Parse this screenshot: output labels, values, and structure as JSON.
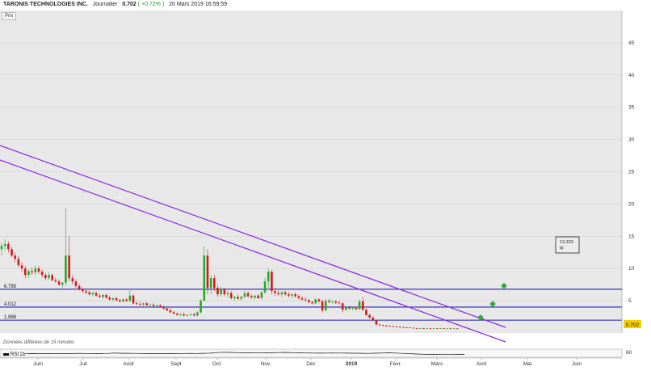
{
  "header": {
    "name": "TARONIS TECHNOLOGIES INC.",
    "period": "Journalier",
    "price": "0.702",
    "change": "( +0.72% )",
    "datetime": "20 Mars 2019 16:59:59"
  },
  "panel_label": "Prix",
  "delayed_note": "Données différées de 15 minutes",
  "rsi_label": "RSI 21",
  "last_price_tag": "0.702",
  "annotation": {
    "value": "13.323",
    "sub": "tp"
  },
  "colors": {
    "plot_bg": "#e8e8e8",
    "grid": "#d2d2d2",
    "up": "#2aa82a",
    "down": "#d11c1c",
    "hline": "#1f22b8",
    "trend": "#8a2be2",
    "diamond": "#33b033",
    "tag": "#f5d000"
  },
  "chart_data": [
    {
      "type": "candlestick",
      "title": "",
      "xlabel": "",
      "ylabel": "",
      "ylim": [
        0,
        50
      ],
      "y_ticks": [
        "5",
        "10",
        "15",
        "20",
        "25",
        "30",
        "35",
        "40",
        "45"
      ],
      "x_labels": [
        "Juin",
        "Juil",
        "Août",
        "Sept",
        "Oct.",
        "Nov.",
        "Déc",
        "2019",
        "Févr.",
        "Mars",
        "Avril",
        "Mai",
        "Juin"
      ],
      "grid": true,
      "horizontal_levels": [
        {
          "label": "6.795",
          "value": 6.795
        },
        {
          "label": "4.012",
          "value": 4.012
        },
        {
          "label": "1.988",
          "value": 1.988
        }
      ],
      "last_price": 0.702,
      "series": [
        {
          "values": [
            [
              13,
              14,
              12,
              13.5
            ],
            [
              13.5,
              14.5,
              12.8,
              13.8
            ],
            [
              13.8,
              14.2,
              12.5,
              13
            ],
            [
              13,
              13.4,
              11.8,
              12
            ],
            [
              12,
              12.5,
              11,
              11.5
            ],
            [
              11.5,
              12,
              10.2,
              10.5
            ],
            [
              10.5,
              11,
              9.5,
              10
            ],
            [
              10,
              10.4,
              8.5,
              9
            ],
            [
              9,
              10,
              8.6,
              9.6
            ],
            [
              9.6,
              10.2,
              9,
              9.4
            ],
            [
              9.4,
              10.5,
              9,
              10
            ],
            [
              10,
              10.4,
              9.2,
              9.5
            ],
            [
              9.5,
              9.8,
              8.6,
              9
            ],
            [
              9,
              9.3,
              8.2,
              8.5
            ],
            [
              8.5,
              9.4,
              8.2,
              9
            ],
            [
              9,
              9.2,
              8,
              8.2
            ],
            [
              8.2,
              8.6,
              7.8,
              8
            ],
            [
              8,
              8.3,
              7.3,
              7.5
            ],
            [
              7.5,
              7.9,
              7,
              7.8
            ],
            [
              7.8,
              19.3,
              7.4,
              12
            ],
            [
              12,
              15,
              8,
              8.5
            ],
            [
              8.5,
              9,
              7.5,
              8
            ],
            [
              8,
              8.3,
              7,
              7.3
            ],
            [
              7.3,
              7.6,
              6.6,
              6.8
            ],
            [
              6.8,
              7.1,
              6.2,
              6.5
            ],
            [
              6.5,
              6.8,
              6,
              6.3
            ],
            [
              6.3,
              6.6,
              5.8,
              6
            ],
            [
              6,
              6.4,
              5.7,
              6.2
            ],
            [
              6.2,
              6.4,
              5.6,
              5.8
            ],
            [
              5.8,
              6.1,
              5.4,
              5.6
            ],
            [
              5.6,
              6,
              5.3,
              5.9
            ],
            [
              5.9,
              6.1,
              5.3,
              5.5
            ],
            [
              5.5,
              5.8,
              5,
              5.2
            ],
            [
              5.2,
              5.5,
              4.9,
              5.4
            ],
            [
              5.4,
              5.6,
              4.9,
              5.1
            ],
            [
              5.1,
              5.3,
              4.7,
              4.9
            ],
            [
              4.9,
              5.4,
              4.7,
              5.2
            ],
            [
              5.2,
              5.4,
              4.8,
              5
            ],
            [
              5,
              6.6,
              4.9,
              5.8
            ],
            [
              5.8,
              6,
              4.4,
              4.6
            ],
            [
              4.6,
              4.9,
              4.3,
              4.5
            ],
            [
              4.5,
              4.8,
              4.2,
              4.4
            ],
            [
              4.4,
              4.7,
              4.1,
              4.6
            ],
            [
              4.6,
              4.8,
              4.2,
              4.3
            ],
            [
              4.3,
              4.6,
              4,
              4.4
            ],
            [
              4.4,
              4.6,
              4.1,
              4.2
            ],
            [
              4.2,
              4.5,
              3.9,
              4.3
            ],
            [
              4.3,
              4.5,
              3.9,
              4
            ],
            [
              4,
              4.3,
              3.6,
              3.8
            ],
            [
              3.8,
              4.1,
              3.4,
              3.5
            ],
            [
              3.5,
              3.8,
              3.1,
              3.2
            ],
            [
              3.2,
              3.5,
              2.9,
              3
            ],
            [
              3,
              3.2,
              2.7,
              2.8
            ],
            [
              2.8,
              3.1,
              2.6,
              2.9
            ],
            [
              2.9,
              3.2,
              2.6,
              2.7
            ],
            [
              2.7,
              3,
              2.5,
              2.8
            ],
            [
              2.8,
              3.1,
              2.6,
              2.9
            ],
            [
              2.9,
              3.2,
              2.6,
              2.7
            ],
            [
              2.7,
              3.4,
              2.6,
              3.2
            ],
            [
              3.2,
              5.3,
              3,
              5
            ],
            [
              5,
              13.5,
              5,
              12
            ],
            [
              12,
              13,
              6,
              7
            ],
            [
              7,
              9,
              6,
              8.5
            ],
            [
              8.5,
              9,
              6.5,
              7
            ],
            [
              7,
              7.5,
              5.6,
              6
            ],
            [
              6,
              7.2,
              5.6,
              6.8
            ],
            [
              6.8,
              7,
              5.7,
              6
            ],
            [
              6,
              6.5,
              5.5,
              6.2
            ],
            [
              6.2,
              6.5,
              5.2,
              5.4
            ],
            [
              5.4,
              5.8,
              5,
              5.6
            ],
            [
              5.6,
              6,
              5.2,
              5.3
            ],
            [
              5.3,
              5.8,
              5,
              5.6
            ],
            [
              5.6,
              6.5,
              5.4,
              6.2
            ],
            [
              6.2,
              6.4,
              5.5,
              5.7
            ],
            [
              5.7,
              6,
              5.3,
              5.5
            ],
            [
              5.5,
              5.9,
              5.2,
              5.8
            ],
            [
              5.8,
              6,
              5.3,
              5.4
            ],
            [
              5.4,
              6.5,
              5.2,
              6.3
            ],
            [
              6.3,
              8.6,
              6,
              8
            ],
            [
              8,
              10,
              7,
              9.5
            ],
            [
              9.5,
              9.8,
              6,
              6.5
            ],
            [
              6.5,
              7,
              5.8,
              6.2
            ],
            [
              6.2,
              6.6,
              5.7,
              6
            ],
            [
              6,
              6.5,
              5.6,
              6.3
            ],
            [
              6.3,
              6.6,
              5.8,
              6
            ],
            [
              6,
              6.4,
              5.5,
              5.8
            ],
            [
              5.8,
              6.2,
              5.4,
              6
            ],
            [
              6,
              6.3,
              5.5,
              5.7
            ],
            [
              5.7,
              6,
              5.2,
              5.4
            ],
            [
              5.4,
              5.7,
              5,
              5.2
            ],
            [
              5.2,
              5.5,
              4.8,
              5.1
            ],
            [
              5.1,
              5.3,
              4.6,
              4.8
            ],
            [
              4.8,
              5,
              4.4,
              4.6
            ],
            [
              4.6,
              5.4,
              4.5,
              5.2
            ],
            [
              5.2,
              5.4,
              4.7,
              4.9
            ],
            [
              4.9,
              5.2,
              3.2,
              3.5
            ],
            [
              3.5,
              5.3,
              3.4,
              5
            ],
            [
              5,
              5.3,
              4.6,
              4.8
            ],
            [
              4.8,
              5.1,
              4.5,
              4.9
            ],
            [
              4.9,
              5.1,
              4.5,
              4.7
            ],
            [
              4.7,
              5,
              4.4,
              4.6
            ],
            [
              4.6,
              4.8,
              3.2,
              3.6
            ],
            [
              3.6,
              4.2,
              3.4,
              4
            ],
            [
              4,
              4.2,
              3.6,
              3.8
            ],
            [
              3.8,
              4.1,
              3.5,
              3.9
            ],
            [
              3.9,
              4.1,
              3.5,
              3.7
            ],
            [
              3.7,
              5.2,
              3.6,
              4.9
            ],
            [
              4.9,
              5.6,
              3.4,
              3.6
            ],
            [
              3.6,
              3.8,
              2.6,
              2.8
            ],
            [
              2.8,
              3,
              2.2,
              2.4
            ],
            [
              2.4,
              2.6,
              1.8,
              2
            ],
            [
              2,
              2.1,
              1.2,
              1.3
            ],
            [
              1.3,
              1.4,
              1.1,
              1.2
            ],
            [
              1.2,
              1.3,
              1.1,
              1.15
            ],
            [
              1.15,
              1.25,
              1,
              1.1
            ],
            [
              1.1,
              1.2,
              1,
              1.05
            ],
            [
              1.05,
              1.15,
              0.95,
              1
            ],
            [
              1,
              1.1,
              0.9,
              0.95
            ],
            [
              0.95,
              1.05,
              0.88,
              0.9
            ],
            [
              0.9,
              1,
              0.85,
              0.88
            ],
            [
              0.88,
              0.95,
              0.82,
              0.85
            ],
            [
              0.85,
              0.9,
              0.78,
              0.8
            ],
            [
              0.8,
              0.85,
              0.72,
              0.75
            ],
            [
              0.75,
              0.8,
              0.68,
              0.7
            ],
            [
              0.7,
              0.78,
              0.66,
              0.74
            ],
            [
              0.74,
              0.78,
              0.68,
              0.7
            ],
            [
              0.7,
              0.76,
              0.66,
              0.72
            ],
            [
              0.72,
              0.76,
              0.66,
              0.68
            ],
            [
              0.68,
              0.74,
              0.64,
              0.72
            ],
            [
              0.72,
              0.76,
              0.66,
              0.7
            ],
            [
              0.7,
              0.74,
              0.65,
              0.72
            ],
            [
              0.72,
              0.75,
              0.66,
              0.69
            ],
            [
              0.69,
              0.74,
              0.65,
              0.71
            ],
            [
              0.71,
              0.74,
              0.66,
              0.7
            ],
            [
              0.7,
              0.73,
              0.66,
              0.71
            ],
            [
              0.71,
              0.74,
              0.67,
              0.702
            ]
          ]
        }
      ],
      "signal_points": [
        {
          "label": "2019-04",
          "value": 2.4
        },
        {
          "label": "2019-04",
          "value": 4.5
        },
        {
          "label": "2019-04",
          "value": 7.3
        }
      ]
    },
    {
      "type": "line",
      "title": "RSI 21",
      "ylim": [
        0,
        100
      ],
      "y_ticks": [
        "60"
      ],
      "series": [
        {
          "name": "RSI 21",
          "values": [
            42,
            45,
            44,
            46,
            47,
            45,
            44,
            46,
            48,
            47,
            46,
            45,
            47,
            52,
            50,
            49,
            48,
            47,
            46,
            45,
            44,
            45,
            46,
            47,
            48,
            47,
            49,
            50,
            58,
            62,
            60,
            57,
            55,
            54,
            53,
            55,
            56,
            58,
            60,
            57,
            55,
            53,
            52,
            51,
            52,
            53,
            52,
            51,
            50,
            49,
            48,
            50,
            52,
            55,
            52,
            48,
            44,
            40,
            37,
            35,
            34,
            33,
            33,
            34,
            34
          ]
        }
      ]
    }
  ]
}
